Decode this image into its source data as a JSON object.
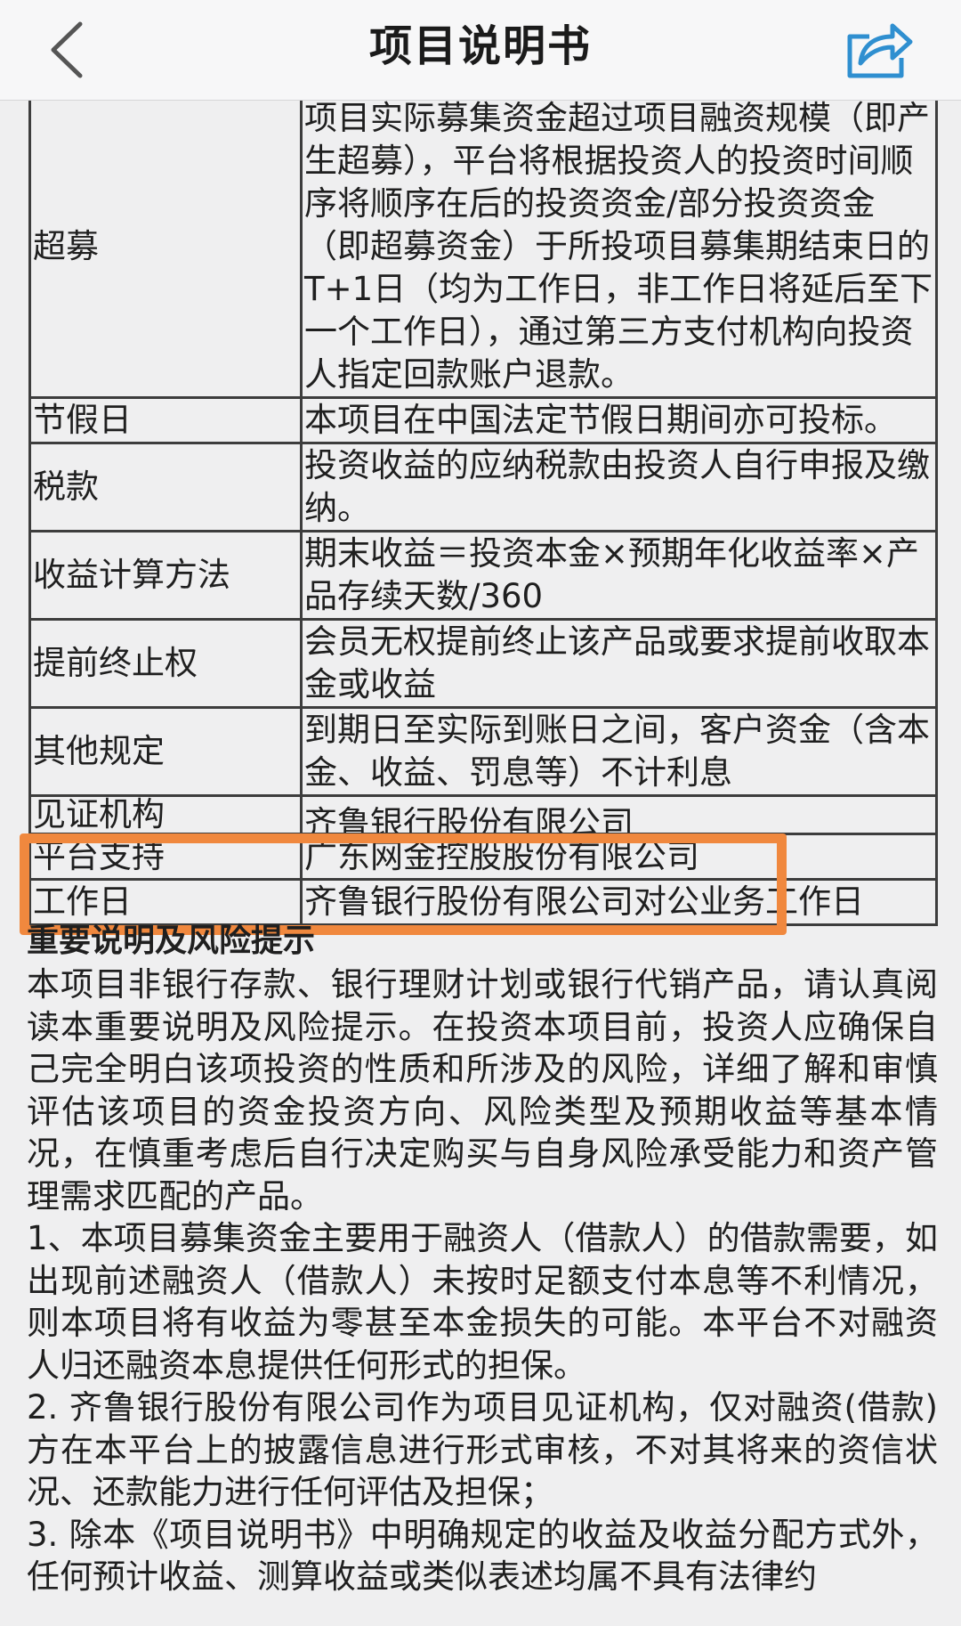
{
  "header": {
    "title": "项目说明书",
    "back_icon": "chevron-left-icon",
    "share_icon": "share-icon"
  },
  "colors": {
    "background": "#efeff0",
    "header_bg": "#f7f7f8",
    "border": "#3d3d3d",
    "highlight": "#f0883e",
    "share_icon": "#2f8fd0"
  },
  "table": {
    "rows": [
      {
        "label": "超募",
        "value": "项目实际募集资金超过项目融资规模（即产生超募），平台将根据投资人的投资时间顺序将顺序在后的投资资金/部分投资资金（即超募资金）于所投项目募集期结束日的T+1日（均为工作日，非工作日将延后至下一个工作日），通过第三方支付机构向投资人指定回款账户退款。"
      },
      {
        "label": "节假日",
        "value": "本项目在中国法定节假日期间亦可投标。"
      },
      {
        "label": "税款",
        "value": "投资收益的应纳税款由投资人自行申报及缴纳。"
      },
      {
        "label": "收益计算方法",
        "value": "期末收益＝投资本金×预期年化收益率×产品存续天数/360"
      },
      {
        "label": "提前终止权",
        "value": "会员无权提前终止该产品或要求提前收取本金或收益"
      },
      {
        "label": "其他规定",
        "value": "到期日至实际到账日之间，客户资金（含本金、收益、罚息等）不计利息"
      },
      {
        "label": "见证机构",
        "value": "齐鲁银行股份有限公司"
      },
      {
        "label": "平台支持",
        "value": "广东网金控股股份有限公司"
      },
      {
        "label": "工作日",
        "value": "齐鲁银行股份有限公司对公业务工作日"
      }
    ]
  },
  "notice": {
    "title": "重要说明及风险提示",
    "paragraphs": [
      "本项目非银行存款、银行理财计划或银行代销产品，请认真阅读本重要说明及风险提示。在投资本项目前，投资人应确保自己完全明白该项投资的性质和所涉及的风险，详细了解和审慎评估该项目的资金投资方向、风险类型及预期收益等基本情况，在慎重考虑后自行决定购买与自身风险承受能力和资产管理需求匹配的产品。",
      "1、本项目募集资金主要用于融资人（借款人）的借款需要，如出现前述融资人（借款人）未按时足额支付本息等不利情况，则本项目将有收益为零甚至本金损失的可能。本平台不对融资人归还融资本息提供任何形式的担保。",
      "2. 齐鲁银行股份有限公司作为项目见证机构，仅对融资(借款)方在本平台上的披露信息进行形式审核，不对其将来的资信状况、还款能力进行任何评估及担保；",
      "3. 除本《项目说明书》中明确规定的收益及收益分配方式外，任何预计收益、测算收益或类似表述均属不具有法律约"
    ]
  }
}
